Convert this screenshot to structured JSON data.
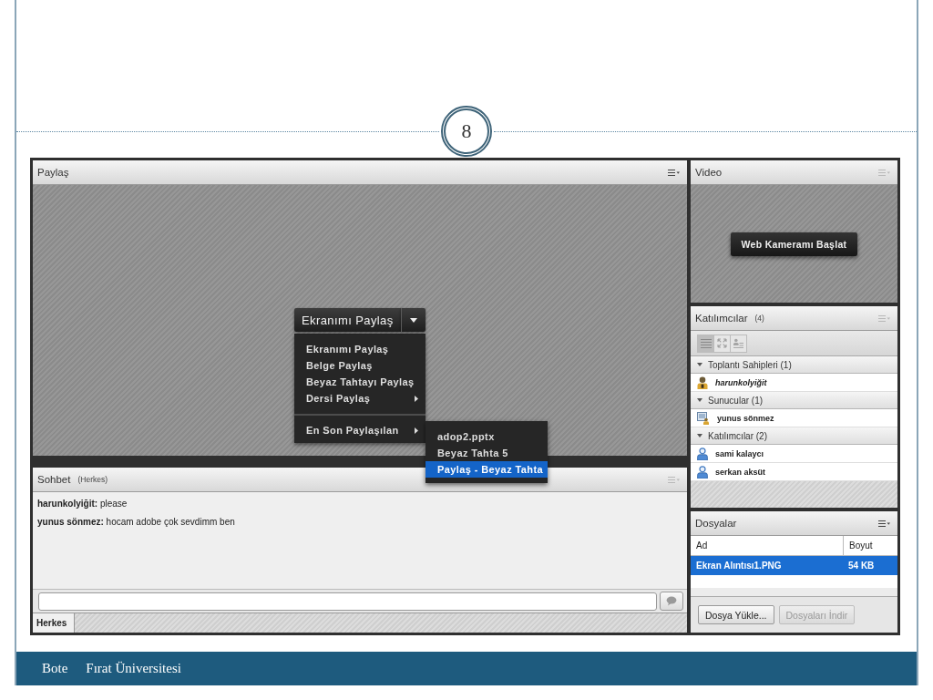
{
  "slide": {
    "number": "8"
  },
  "share_pod": {
    "title": "Paylaş",
    "menu_enabled": true,
    "share_button": "Ekranımı Paylaş",
    "menu": [
      {
        "kind": "item",
        "label": "Ekranımı Paylaş",
        "submenu": false
      },
      {
        "kind": "item",
        "label": "Belge Paylaş",
        "submenu": false
      },
      {
        "kind": "item",
        "label": "Beyaz Tahtayı Paylaş",
        "submenu": false
      },
      {
        "kind": "item",
        "label": "Dersi Paylaş",
        "submenu": true
      },
      {
        "kind": "separator"
      },
      {
        "kind": "item",
        "label": "En Son Paylaşılan",
        "submenu": true,
        "submenu_items": [
          {
            "label": "adop2.pptx",
            "selected": false
          },
          {
            "label": "Beyaz Tahta 5",
            "selected": false
          },
          {
            "label": "Paylaş - Beyaz Tahta",
            "selected": true
          }
        ]
      }
    ]
  },
  "video_pod": {
    "title": "Video",
    "menu_enabled": false,
    "button": "Web Kameramı Başlat"
  },
  "attendees_pod": {
    "title": "Katılımcılar",
    "count": "(4)",
    "menu_enabled": false,
    "view_buttons": [
      {
        "kind": "list",
        "selected": true
      },
      {
        "kind": "arrows",
        "selected": false
      },
      {
        "kind": "details",
        "selected": false
      }
    ],
    "groups": [
      {
        "label": "Toplantı Sahipleri (1)",
        "expanded": true,
        "members": [
          {
            "kind": "host",
            "name": "harunkolyiğit"
          }
        ]
      },
      {
        "label": "Sunucular (1)",
        "expanded": true,
        "members": [
          {
            "kind": "presenter",
            "name": "yunus sönmez"
          }
        ]
      },
      {
        "label": "Katılımcılar (2)",
        "expanded": true,
        "members": [
          {
            "kind": "participant",
            "name": "sami kalaycı"
          },
          {
            "kind": "participant",
            "name": "serkan aksüt"
          }
        ]
      }
    ]
  },
  "chat_pod": {
    "title": "Sohbet",
    "scope": "(Herkes)",
    "menu_enabled": false,
    "messages": [
      "**harunkolyiğit:** please",
      "**yunus sönmez:** hocam adobe çok sevdimm ben"
    ],
    "tabs": [
      {
        "label": "Herkes",
        "selected": true
      }
    ]
  },
  "files_pod": {
    "title": "Dosyalar",
    "menu_enabled": true,
    "columns": [
      "Ad",
      "Boyut"
    ],
    "rows": [
      {
        "cells": [
          "Ekran Alıntısı1.PNG",
          "54 KB"
        ],
        "selected": true
      }
    ],
    "buttons": [
      {
        "label": "Dosya Yükle...",
        "disabled": false
      },
      {
        "label": "Dosyaları İndir",
        "disabled": true
      }
    ]
  },
  "footer": [
    "Bote",
    "Fırat Üniversitesi"
  ]
}
